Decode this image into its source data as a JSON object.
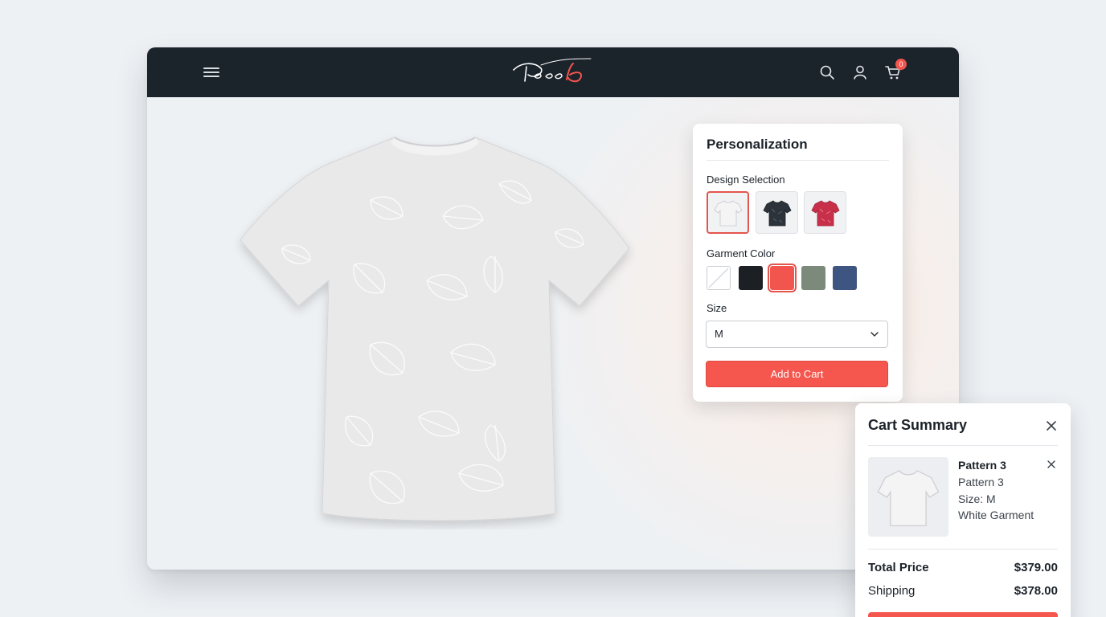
{
  "header": {
    "logo_text": "Teeb",
    "cart_count": "0",
    "icons": [
      "menu-icon",
      "search-icon",
      "user-icon",
      "cart-icon"
    ]
  },
  "personalization": {
    "title": "Personalization",
    "design_label": "Design Selection",
    "designs": [
      {
        "name": "white-tee",
        "selected": true
      },
      {
        "name": "dark-tee",
        "selected": false
      },
      {
        "name": "red-tee",
        "selected": false
      }
    ],
    "color_label": "Garment Color",
    "colors": [
      {
        "hex": "#ffffff",
        "selected": false
      },
      {
        "hex": "#1c2024",
        "selected": false
      },
      {
        "hex": "#f2554d",
        "selected": true
      },
      {
        "hex": "#7c8a7c",
        "selected": false
      },
      {
        "hex": "#3d5580",
        "selected": false
      }
    ],
    "size_label": "Size",
    "size_value": "M",
    "add_to_cart": "Add to Cart"
  },
  "cart": {
    "title": "Cart Summary",
    "item": {
      "name": "Pattern 3",
      "pattern": "Pattern 3",
      "size": "Size: M",
      "garment": "White Garment"
    },
    "total_label": "Total Price",
    "total_value": "$379.00",
    "shipping_label": "Shipping",
    "shipping_value": "$378.00"
  },
  "colors": {
    "accent": "#f5564e",
    "header_bg": "#1b232b"
  }
}
